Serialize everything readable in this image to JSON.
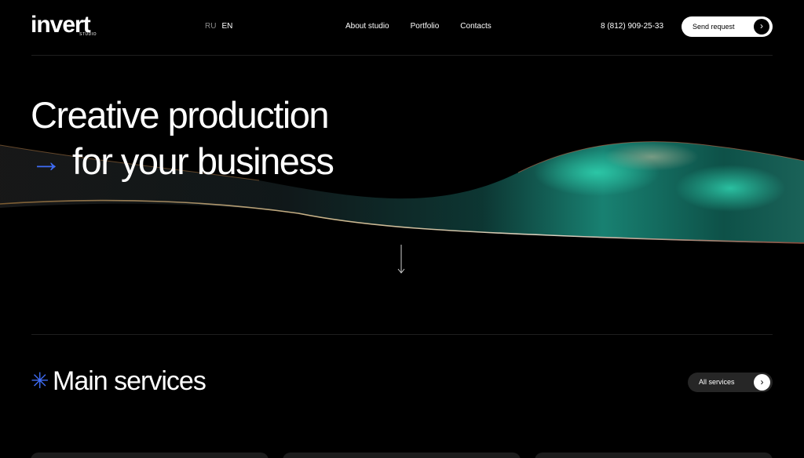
{
  "header": {
    "logo_text": "invert",
    "logo_sub": "STUDIO",
    "lang": {
      "ru": "RU",
      "en": "EN",
      "active": "EN"
    },
    "nav": [
      "About studio",
      "Portfolio",
      "Contacts"
    ],
    "phone": "8 (812) 909-25-33",
    "cta_label": "Send request",
    "cta_icon": "chevron-right-icon"
  },
  "hero": {
    "line1": "Creative production",
    "line2": "for your business",
    "arrow_icon": "arrow-right-icon",
    "accent_color": "#3f6cf5",
    "scroll_icon": "arrow-down-icon"
  },
  "services": {
    "title": "Main services",
    "title_icon": "asterisk-icon",
    "all_label": "All services",
    "all_icon": "chevron-right-icon"
  },
  "colors": {
    "background": "#000000",
    "accent": "#3f6cf5",
    "wave_teal": "#1fa88f"
  }
}
